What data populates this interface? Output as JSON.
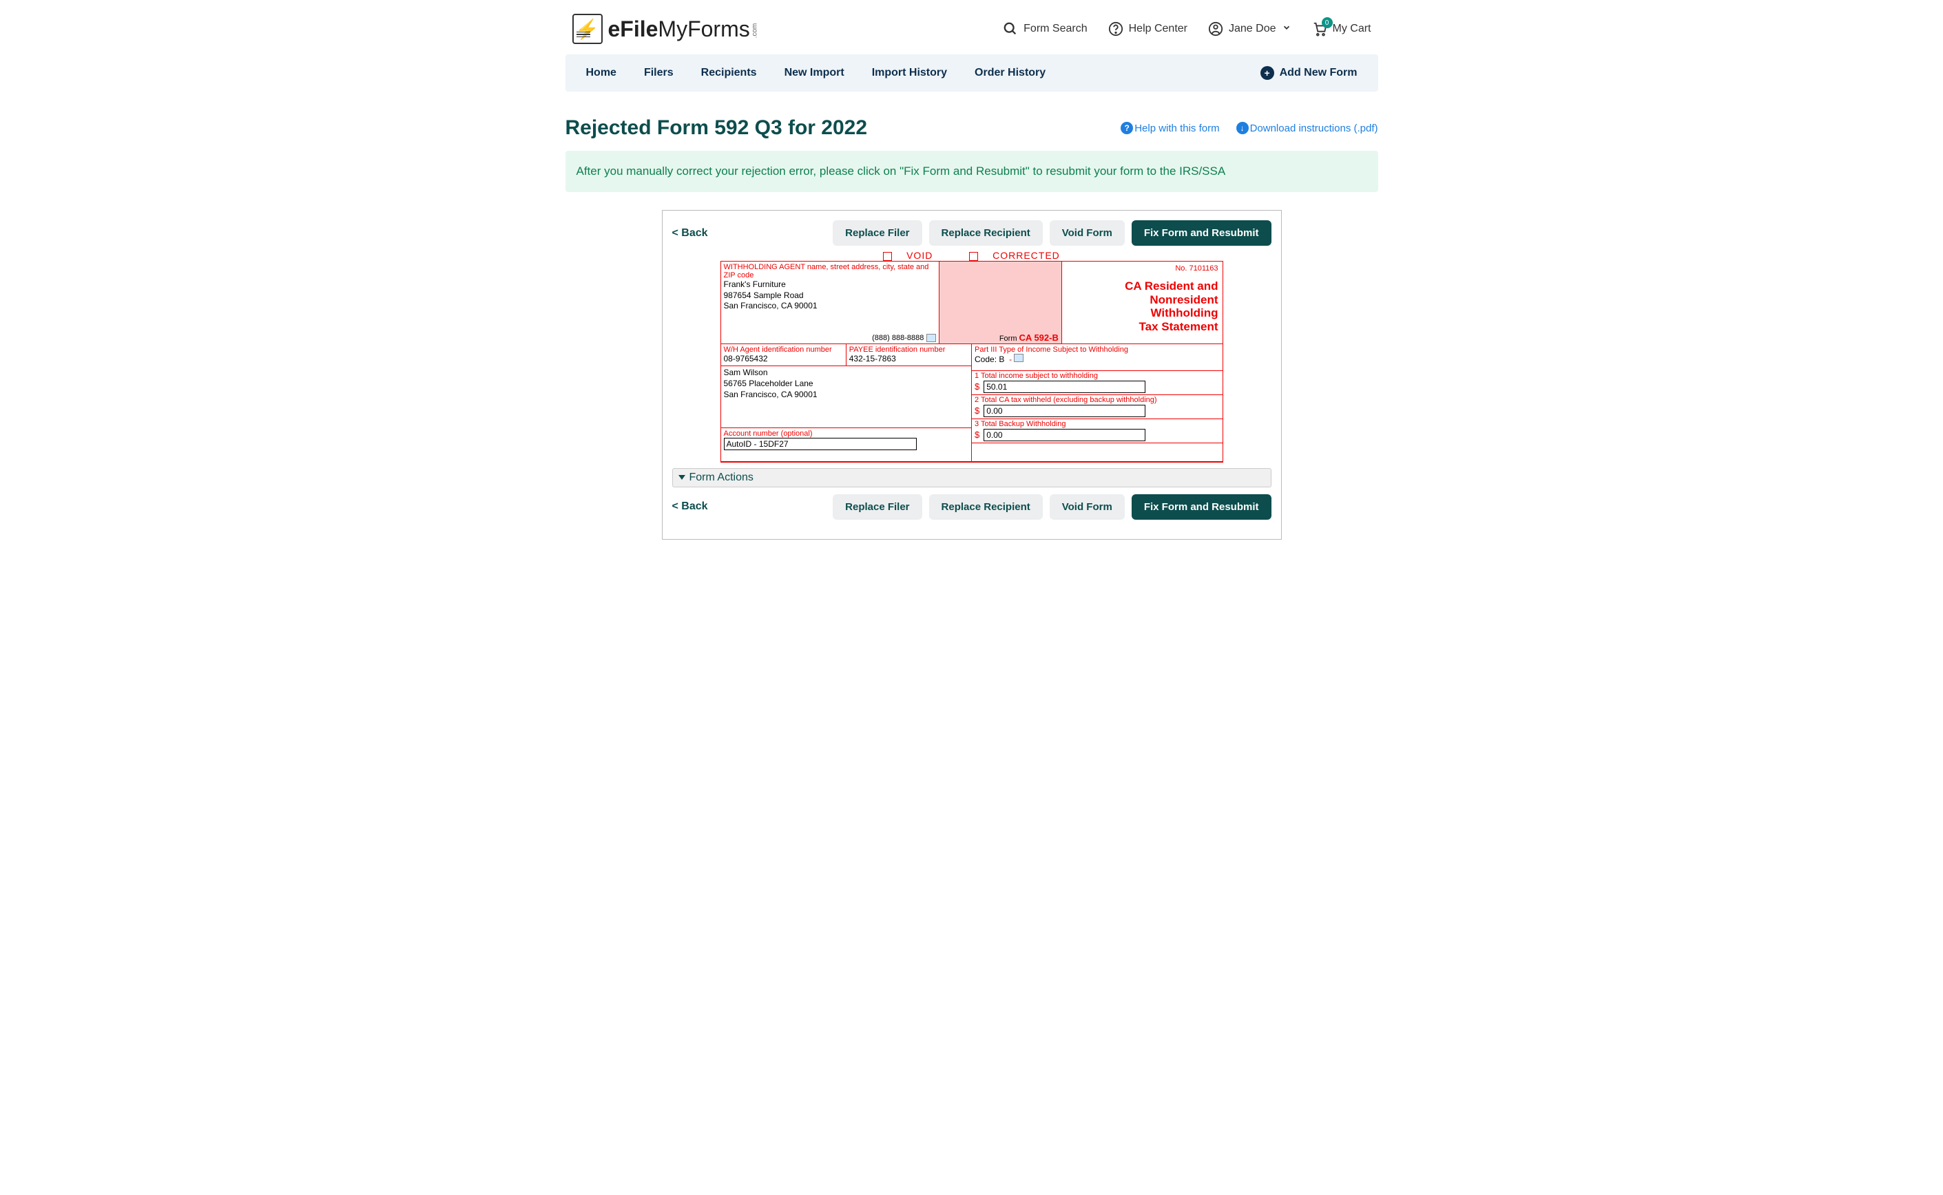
{
  "header": {
    "logo_bold": "eFile",
    "logo_light": "MyForms",
    "logo_suffix": ".com",
    "form_search": "Form Search",
    "help_center": "Help Center",
    "user_name": "Jane Doe",
    "cart_label": "My Cart",
    "cart_count": "0"
  },
  "nav": {
    "items": [
      "Home",
      "Filers",
      "Recipients",
      "New Import",
      "Import History",
      "Order History"
    ],
    "add_form": "Add New Form"
  },
  "page": {
    "title": "Rejected Form 592 Q3 for 2022",
    "help_link": "Help with this form",
    "download_link": "Download instructions (.pdf)"
  },
  "alert": "After you manually correct your rejection error, please click on \"Fix Form and Resubmit\" to resubmit your form to the IRS/SSA",
  "buttons": {
    "back": "< Back",
    "replace_filer": "Replace Filer",
    "replace_recipient": "Replace Recipient",
    "void_form": "Void Form",
    "fix_resubmit": "Fix Form and Resubmit"
  },
  "taxform": {
    "void_label": "VOID",
    "corrected_label": "CORRECTED",
    "agent_label": "WITHHOLDING AGENT name, street address, city, state and ZIP code",
    "agent_name": "Frank's Furniture",
    "agent_street": "987654 Sample Road",
    "agent_citystate": "San Francisco, CA 90001",
    "agent_phone": "(888) 888-8888",
    "form_no": "No. 7101163",
    "form_id_prefix": "Form",
    "form_id": "CA 592-B",
    "form_title_l1": "CA Resident and",
    "form_title_l2": "Nonresident",
    "form_title_l3": "Withholding",
    "form_title_l4": "Tax Statement",
    "wh_agent_id_label": "W/H Agent identification number",
    "wh_agent_id": "08-9765432",
    "payee_id_label": "PAYEE identification number",
    "payee_id": "432-15-7863",
    "payee_name": "Sam Wilson",
    "payee_street": "56765 Placeholder Lane",
    "payee_citystate": "San Francisco, CA 90001",
    "part3_label": "Part III Type of Income Subject to Withholding",
    "part3_code_label": "Code:",
    "part3_code": "B",
    "amt1_label": "1  Total income subject to withholding",
    "amt1": "50.01",
    "amt2_label": "2  Total CA tax withheld (excluding backup withholding)",
    "amt2": "0.00",
    "amt3_label": "3  Total Backup Withholding",
    "amt3": "0.00",
    "acct_label": "Account number (optional)",
    "acct": "AutoID - 15DF27"
  },
  "form_actions_header": "Form Actions"
}
